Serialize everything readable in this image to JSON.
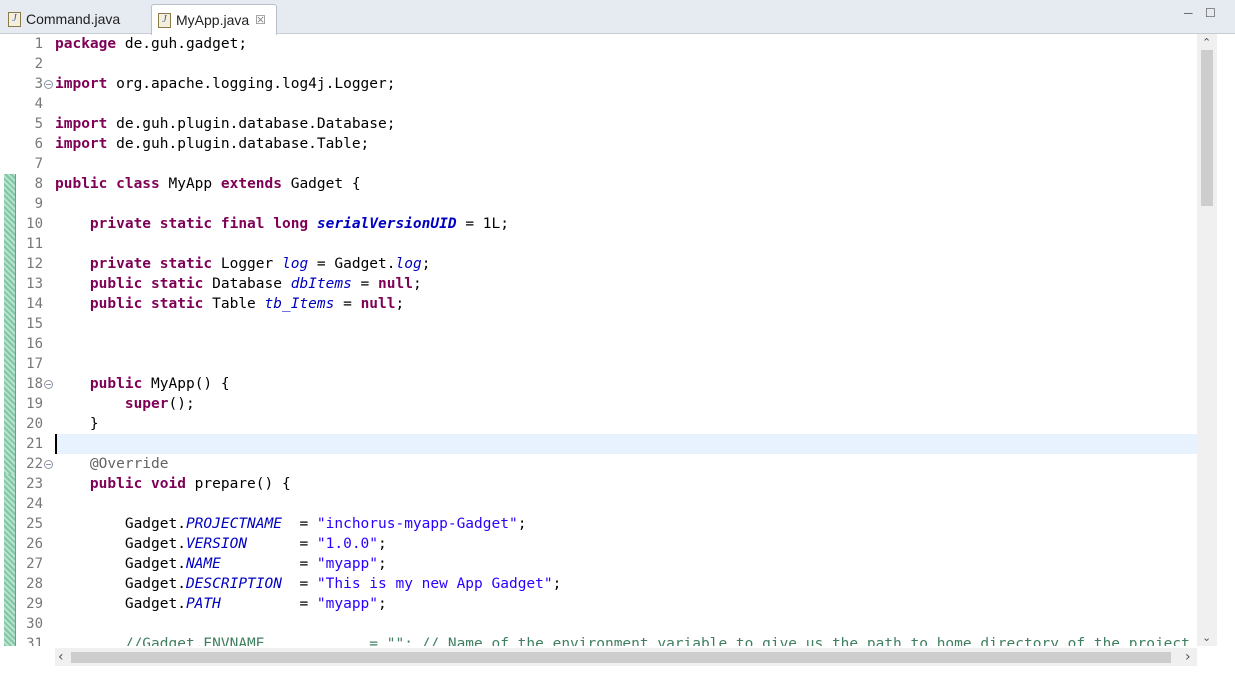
{
  "tabs": [
    {
      "label": "Command.java",
      "icon": "java-file-icon",
      "active": false
    },
    {
      "label": "MyApp.java",
      "icon": "java-file-icon",
      "active": true,
      "close": "☒"
    }
  ],
  "window_controls": {
    "minimize": "─",
    "maximize": "☐"
  },
  "editor": {
    "current_line": 21,
    "lines": [
      {
        "n": "1"
      },
      {
        "n": "2"
      },
      {
        "n": "3"
      },
      {
        "n": "4"
      },
      {
        "n": "5"
      },
      {
        "n": "6"
      },
      {
        "n": "7"
      },
      {
        "n": "8"
      },
      {
        "n": "9"
      },
      {
        "n": "10"
      },
      {
        "n": "11"
      },
      {
        "n": "12"
      },
      {
        "n": "13"
      },
      {
        "n": "14"
      },
      {
        "n": "15"
      },
      {
        "n": "16"
      },
      {
        "n": "17"
      },
      {
        "n": "18"
      },
      {
        "n": "19"
      },
      {
        "n": "20"
      },
      {
        "n": "21"
      },
      {
        "n": "22"
      },
      {
        "n": "23"
      },
      {
        "n": "24"
      },
      {
        "n": "25"
      },
      {
        "n": "26"
      },
      {
        "n": "27"
      },
      {
        "n": "28"
      },
      {
        "n": "29"
      },
      {
        "n": "30"
      },
      {
        "n": "31"
      }
    ],
    "code": {
      "l1": {
        "kw": "package",
        "rest": " de.guh.gadget;"
      },
      "l3": {
        "kw": "import",
        "rest": " org.apache.logging.log4j.Logger;"
      },
      "l5": {
        "kw": "import",
        "rest": " de.guh.plugin.database.Database;"
      },
      "l6": {
        "kw": "import",
        "rest": " de.guh.plugin.database.Table;"
      },
      "l8": {
        "kw1": "public class",
        "name": " MyApp ",
        "kw2": "extends",
        "rest": " Gadget {"
      },
      "l10": {
        "kw": "    private static final long",
        "sp": " ",
        "field": "serialVersionUID",
        "rest": " = 1L;"
      },
      "l12": {
        "kw": "    private static",
        "mid": " Logger ",
        "field": "log",
        "eq": " = Gadget.",
        "field2": "log",
        "end": ";"
      },
      "l13": {
        "kw": "    public static",
        "mid": " Database ",
        "field": "dbItems",
        "eq": " = ",
        "kw2": "null",
        "end": ";"
      },
      "l14": {
        "kw": "    public static",
        "mid": " Table ",
        "field": "tb_Items",
        "eq": " = ",
        "kw2": "null",
        "end": ";"
      },
      "l18": {
        "kw": "    public",
        "rest": " MyApp() {"
      },
      "l19": {
        "kw": "        super",
        "rest": "();"
      },
      "l20": {
        "rest": "    }"
      },
      "l22": {
        "ann": "    @Override"
      },
      "l23": {
        "kw": "    public void",
        "rest": " prepare() {"
      },
      "l25": {
        "pre": "        Gadget.",
        "field": "PROJECTNAME",
        "eq": "  = ",
        "str": "\"inchorus-myapp-Gadget\"",
        "end": ";"
      },
      "l26": {
        "pre": "        Gadget.",
        "field": "VERSION",
        "eq": "      = ",
        "str": "\"1.0.0\"",
        "end": ";"
      },
      "l27": {
        "pre": "        Gadget.",
        "field": "NAME",
        "eq": "         = ",
        "str": "\"myapp\"",
        "end": ";"
      },
      "l28": {
        "pre": "        Gadget.",
        "field": "DESCRIPTION",
        "eq": "  = ",
        "str": "\"This is my new App Gadget\"",
        "end": ";"
      },
      "l29": {
        "pre": "        Gadget.",
        "field": "PATH",
        "eq": "         = ",
        "str": "\"myapp\"",
        "end": ";"
      },
      "l31": {
        "cmt": "        //Gadget.ENVNAME            = \"\"; // Name of the environment variable to give us the path to home directory of the project"
      }
    }
  },
  "scroll": {
    "up": "⌃",
    "down": "⌄",
    "left": "‹",
    "right": "›"
  },
  "colors": {
    "keyword": "#7f0055",
    "field": "#0000c0",
    "string": "#2a00ff",
    "annotation": "#646464",
    "comment": "#3f7f5f",
    "line_number": "#787878",
    "current_line": "#e8f2fe"
  }
}
